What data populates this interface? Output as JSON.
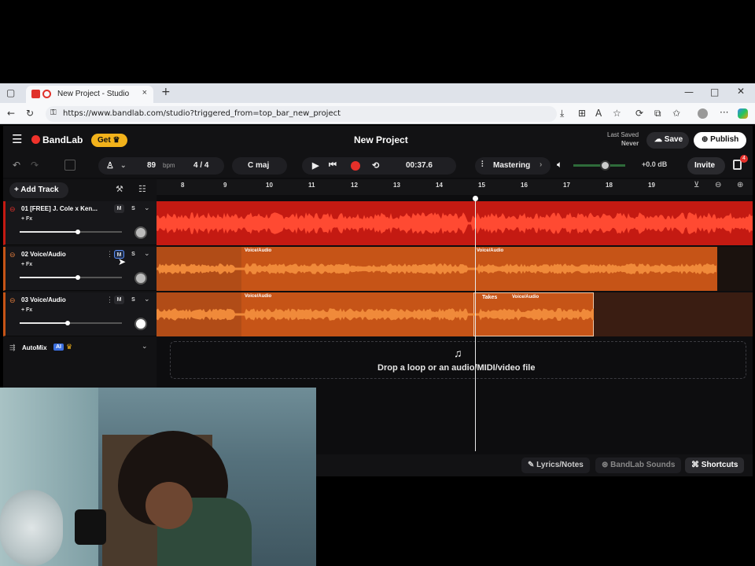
{
  "browser": {
    "tab_title": "New Project - Studio",
    "url": "https://www.bandlab.com/studio?triggered_from=top_bar_new_project"
  },
  "header": {
    "brand": "BandLab",
    "get_label": "Get",
    "project_title": "New Project",
    "last_saved_label": "Last Saved",
    "last_saved_value": "Never",
    "save_label": "Save",
    "publish_label": "Publish",
    "notifications_count": "4"
  },
  "toolbar": {
    "tempo": "89",
    "tempo_unit": "bpm",
    "time_signature": "4 / 4",
    "key": "C maj",
    "time_display": "00:37.6",
    "mastering_label": "Mastering",
    "volume_db": "+0.0 dB",
    "volume_level": 0.6,
    "invite_label": "Invite"
  },
  "tracks_panel": {
    "add_track_label": "Add Track",
    "tracks": [
      {
        "name": "01  [FREE] J. Cole x Ken...",
        "fx": "+ Fx",
        "mute": "M",
        "solo": "S",
        "volume": 0.57
      },
      {
        "name": "02  Voice/Audio",
        "fx": "+ Fx",
        "mute": "M",
        "solo": "S",
        "volume": 0.57
      },
      {
        "name": "03  Voice/Audio",
        "fx": "+ Fx",
        "mute": "M",
        "solo": "S",
        "volume": 0.47
      }
    ],
    "automix_label": "AutoMix",
    "automix_badge": "AI"
  },
  "timeline": {
    "bars": [
      "8",
      "9",
      "10",
      "11",
      "12",
      "13",
      "14",
      "15",
      "16",
      "17",
      "18",
      "19"
    ],
    "clip_labels": {
      "t2_a": "Voice/Audio",
      "t2_b": "Voice/Audio",
      "t3_a": "Voice/Audio",
      "t3_b": "Voice/Audio",
      "takes": "Takes"
    },
    "colors": {
      "track1": "#c41a12",
      "track2": "#c65417",
      "track3": "#c65417",
      "track3_dim": "#4a2416"
    }
  },
  "drop_zone": {
    "text": "Drop a loop or an audio/MIDI/video file"
  },
  "bottom_bar": {
    "lyrics_label": "Lyrics/Notes",
    "sounds_label": "BandLab Sounds",
    "shortcuts_label": "Shortcuts"
  }
}
